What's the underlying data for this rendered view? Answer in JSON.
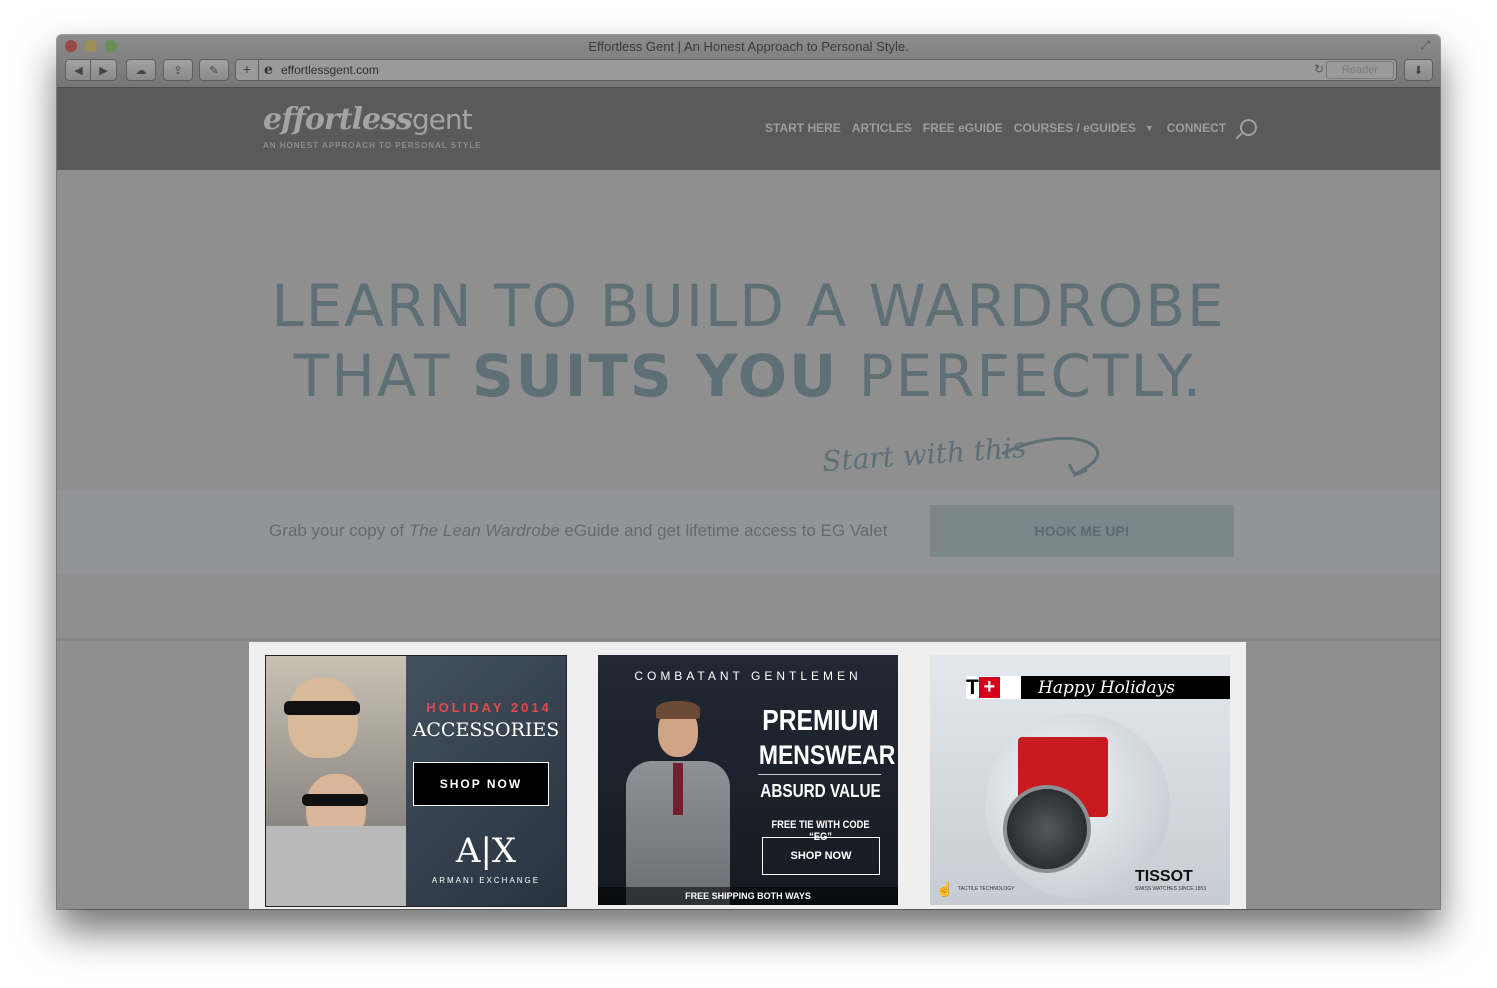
{
  "window": {
    "title": "Effortless Gent | An Honest Approach to Personal Style.",
    "url": "effortlessgent.com",
    "reader_label": "Reader",
    "plus_label": "+",
    "favicon_letter": "e"
  },
  "site": {
    "logo_bold": "effortless",
    "logo_light": "gent",
    "tagline": "AN HONEST APPROACH TO PERSONAL STYLE",
    "nav": [
      "START HERE",
      "ARTICLES",
      "FREE eGUIDE",
      "COURSES / eGUIDES",
      "CONNECT"
    ]
  },
  "hero": {
    "line1": "LEARN TO BUILD A WARDROBE",
    "line2_pre": "THAT ",
    "line2_bold": "SUITS YOU",
    "line2_post": " PERFECTLY.",
    "script_note": "Start with this",
    "cta_pre": "Grab your copy of ",
    "cta_em": "The Lean Wardrobe",
    "cta_post": " eGuide and get lifetime access to EG Valet",
    "cta_button": "HOOK ME UP!"
  },
  "ads": {
    "ax": {
      "headline": "HOLIDAY 2014",
      "subhead": "ACCESSORIES",
      "button": "SHOP NOW",
      "logo": "A|X",
      "logo_name": "ARMANI EXCHANGE"
    },
    "cg": {
      "brand": "COMBATANT GENTLEMEN",
      "line1": "PREMIUM",
      "line2": "MENSWEAR",
      "line3": "ABSURD VALUE",
      "code": "FREE TIE WITH CODE “EG”",
      "button": "SHOP NOW",
      "shipping": "FREE SHIPPING BOTH WAYS"
    },
    "tissot": {
      "t_letter": "T",
      "plus": "+",
      "greeting": "Happy Holidays",
      "brand": "TISSOT",
      "brand_sub": "SWISS WATCHES SINCE 1853",
      "tactile": "TACTILE TECHNOLOGY"
    }
  }
}
